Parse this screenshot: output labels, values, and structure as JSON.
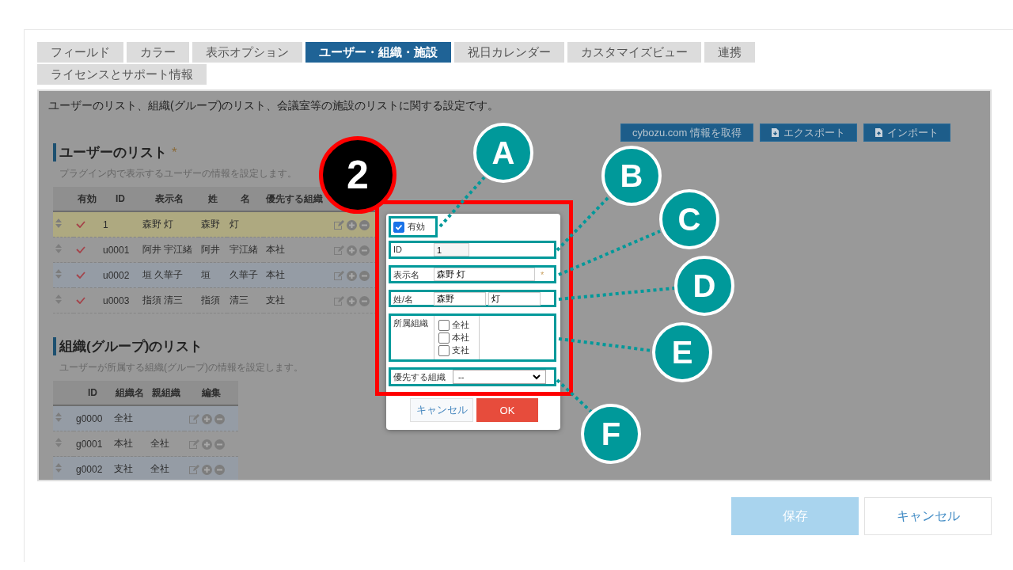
{
  "tabs": [
    {
      "label": "フィールド",
      "selected": false
    },
    {
      "label": "カラー",
      "selected": false
    },
    {
      "label": "表示オプション",
      "selected": false
    },
    {
      "label": "ユーザー・組織・施設",
      "selected": true
    },
    {
      "label": "祝日カレンダー",
      "selected": false
    },
    {
      "label": "カスタマイズビュー",
      "selected": false
    },
    {
      "label": "連携",
      "selected": false
    },
    {
      "label": "ライセンスとサポート情報",
      "selected": false
    }
  ],
  "description": "ユーザーのリスト、組織(グループ)のリスト、会議室等の施設のリストに関する設定です。",
  "toolbar": [
    {
      "label": "cybozu.com 情報を取得",
      "kind": "plain"
    },
    {
      "label": "エクスポート",
      "kind": "export"
    },
    {
      "label": "インポート",
      "kind": "import"
    }
  ],
  "user_list": {
    "title": "ユーザーのリスト",
    "required_mark": "*",
    "subtitle": "プラグイン内で表示するユーザーの情報を設定します。",
    "columns": [
      "有効",
      "ID",
      "表示名",
      "姓",
      "名",
      "優先する組織"
    ],
    "rows": [
      {
        "enabled": true,
        "id": "1",
        "display_name": "森野 灯",
        "last": "森野",
        "first": "灯",
        "org": "",
        "selected": true
      },
      {
        "enabled": true,
        "id": "u0001",
        "display_name": "阿井 宇江緒",
        "last": "阿井",
        "first": "宇江緒",
        "org": "本社",
        "selected": false
      },
      {
        "enabled": true,
        "id": "u0002",
        "display_name": "垣 久華子",
        "last": "垣",
        "first": "久華子",
        "org": "本社",
        "selected": false
      },
      {
        "enabled": true,
        "id": "u0003",
        "display_name": "指須 清三",
        "last": "指須",
        "first": "清三",
        "org": "支社",
        "selected": false
      }
    ]
  },
  "org_list": {
    "title": "組織(グループ)のリスト",
    "subtitle": "ユーザーが所属する組織(グループ)の情報を設定します。",
    "columns": [
      "ID",
      "組織名",
      "親組織",
      "編集"
    ],
    "rows": [
      {
        "id": "g0000",
        "name": "全社",
        "parent": ""
      },
      {
        "id": "g0001",
        "name": "本社",
        "parent": "全社"
      },
      {
        "id": "g0002",
        "name": "支社",
        "parent": "全社"
      }
    ]
  },
  "dialog": {
    "enabled": {
      "label": "有効",
      "checked": true
    },
    "id": {
      "label": "ID",
      "value": "1"
    },
    "display_name": {
      "label": "表示名",
      "value": "森野 灯",
      "required_mark": "*"
    },
    "name": {
      "label": "姓/名",
      "last": "森野",
      "first": "灯"
    },
    "orgs": {
      "label": "所属組織",
      "options": [
        {
          "label": "全社",
          "checked": false
        },
        {
          "label": "本社",
          "checked": false
        },
        {
          "label": "支社",
          "checked": false
        }
      ]
    },
    "priority_org": {
      "label": "優先する組織",
      "value": "--"
    },
    "buttons": {
      "cancel": "キャンセル",
      "ok": "OK"
    }
  },
  "annotations": {
    "step": "2",
    "labels": [
      "A",
      "B",
      "C",
      "D",
      "E",
      "F"
    ]
  },
  "footer": {
    "save": "保存",
    "cancel": "キャンセル"
  }
}
